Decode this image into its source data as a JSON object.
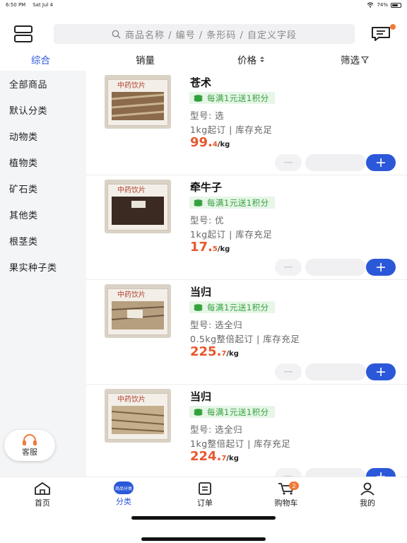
{
  "status": {
    "time": "6:50 PM",
    "date": "Sat Jul 4",
    "battery": "74%",
    "battery_level": 0.74
  },
  "header": {
    "search_placeholder": "商品名称 / 编号 / 条形码 / 自定义字段"
  },
  "sort_tabs": [
    {
      "label": "综合"
    },
    {
      "label": "销量"
    },
    {
      "label": "价格"
    },
    {
      "label": "筛选"
    }
  ],
  "categories": [
    "全部商品",
    "默认分类",
    "动物类",
    "植物类",
    "矿石类",
    "其他类",
    "根茎类",
    "果实种子类"
  ],
  "customer_service": {
    "label": "客服"
  },
  "products": [
    {
      "image_label": "中药饮片",
      "name": "苍术",
      "promo": "每满1元送1积分",
      "spec": "型号:  选",
      "moq": "1kg起订  |  库存充足",
      "price_int": "99.",
      "price_dec": "4",
      "unit": "/kg"
    },
    {
      "image_label": "中药饮片",
      "name": "牵牛子",
      "promo": "每满1元送1积分",
      "spec": "型号:  优",
      "moq": "1kg起订  |  库存充足",
      "price_int": "17.",
      "price_dec": "5",
      "unit": "/kg"
    },
    {
      "image_label": "中药饮片",
      "name": "当归",
      "promo": "每满1元送1积分",
      "spec": "型号:  选全归",
      "moq": "0.5kg整倍起订  |  库存充足",
      "price_int": "225.",
      "price_dec": "7",
      "unit": "/kg"
    },
    {
      "image_label": "中药饮片",
      "name": "当归",
      "promo": "每满1元送1积分",
      "spec": "型号:  选全归",
      "moq": "1kg整倍起订  |  库存充足",
      "price_int": "224.",
      "price_dec": "7",
      "unit": "/kg"
    }
  ],
  "tabbar": [
    {
      "label": "首页"
    },
    {
      "label": "分类",
      "icon_text": "商品分类"
    },
    {
      "label": "订单"
    },
    {
      "label": "购物车",
      "badge": "2"
    },
    {
      "label": "我的"
    }
  ],
  "colors": {
    "accent": "#2b58d9",
    "price": "#e8572e",
    "promo_bg": "#e6f6e7",
    "promo_text": "#35a03d",
    "badge": "#f07a3a"
  }
}
